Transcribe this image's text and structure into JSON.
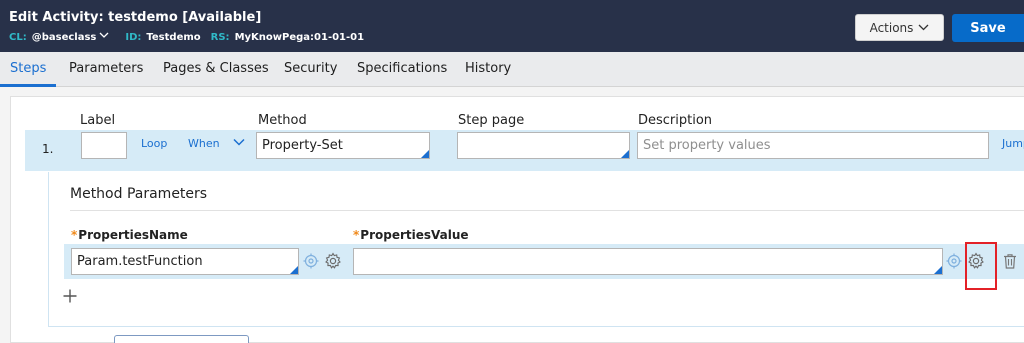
{
  "header": {
    "title": "Edit  Activity: testdemo [Available]",
    "cl_label": "CL:",
    "cl_value": "@baseclass",
    "id_label": "ID:",
    "id_value": "Testdemo",
    "rs_label": "RS:",
    "rs_value": "MyKnowPega:01-01-01",
    "actions_label": "Actions",
    "save_label": "Save"
  },
  "tabs": [
    "Steps",
    "Parameters",
    "Pages & Classes",
    "Security",
    "Specifications",
    "History"
  ],
  "steps": {
    "headers": {
      "label": "Label",
      "method": "Method",
      "step_page": "Step page",
      "description": "Description"
    },
    "row": {
      "number": "1.",
      "label_value": "",
      "loop": "Loop",
      "when": "When",
      "method_value": "Property-Set",
      "step_page_value": "",
      "description_placeholder": "Set property values",
      "jump": "Jump"
    }
  },
  "method_parameters": {
    "title": "Method Parameters",
    "name_header": "PropertiesName",
    "value_header": "PropertiesValue",
    "rows": [
      {
        "name": "Param.testFunction",
        "value": ""
      }
    ]
  },
  "colors": {
    "header_bg": "#283149",
    "meta_label": "#30b9c8",
    "accent": "#1b6fd0",
    "save_bg": "#076bc9",
    "row_bg": "#d6ebf7",
    "required": "#f08a1c",
    "highlight": "#e32127"
  }
}
